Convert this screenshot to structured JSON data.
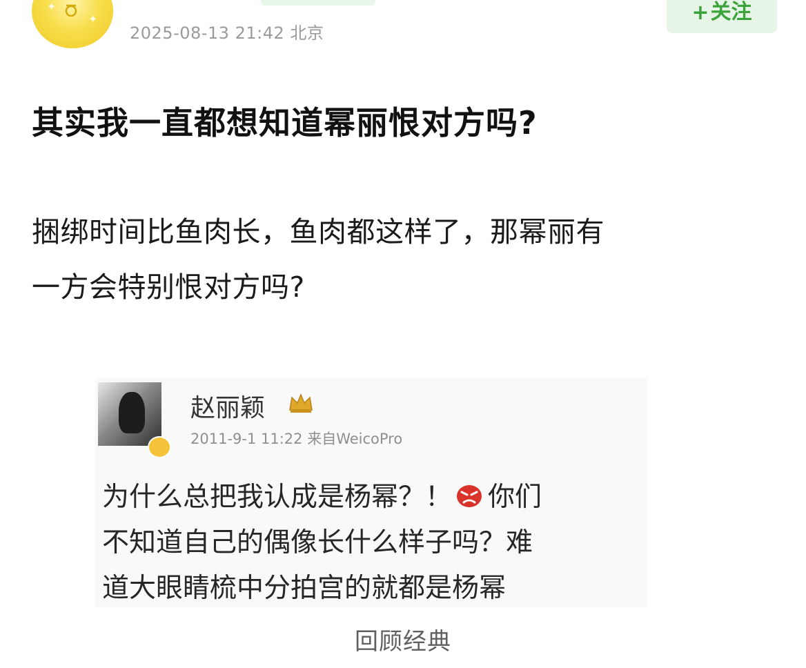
{
  "post": {
    "timestamp": "2025-08-13 21:42",
    "location": "北京",
    "follow_label": "关注",
    "follow_plus": "+",
    "title": "其实我一直都想知道幂丽恨对方吗?",
    "body_line1": "捆绑时间比鱼肉长，鱼肉都这样了，那幂丽有",
    "body_line2": "一方会特别恨对方吗?"
  },
  "quote": {
    "author": "赵丽颖",
    "date": "2011-9-1 11:22",
    "source": "来自WeicoPro",
    "text_before_emoji": "为什么总把我认成是杨幂？！",
    "text_after_emoji": "你们",
    "text_line2": "不知道自己的偶像长什么样子吗？难",
    "text_line3": "道大眼睛梳中分拍宫的就都是杨幂"
  },
  "caption": "回顾经典",
  "colors": {
    "follow_green": "#3ca33a",
    "follow_bg": "#e7f5e7",
    "avatar_yellow": "#f8de4c",
    "emoji_red": "#d9322b"
  },
  "icons": {
    "avatar": "user-avatar",
    "verified": "verified-badge-icon",
    "crown": "vip-crown-icon",
    "emoji": "angry-face-emoji-icon"
  }
}
